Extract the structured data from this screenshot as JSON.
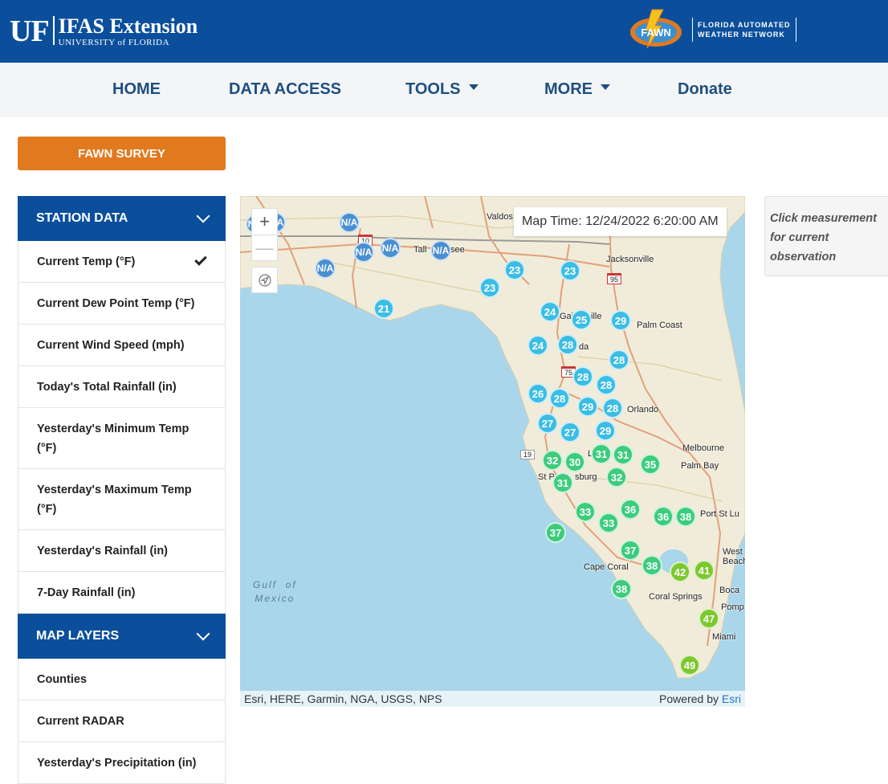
{
  "header": {
    "uf_mark": "UF",
    "org_title": "IFAS Extension",
    "org_subtitle": "UNIVERSITY of FLORIDA",
    "fawn_badge": "FAWN",
    "fawn_line1": "FLORIDA AUTOMATED",
    "fawn_line2": "WEATHER NETWORK"
  },
  "nav": {
    "items": [
      {
        "label": "HOME",
        "dropdown": false
      },
      {
        "label": "DATA ACCESS",
        "dropdown": false
      },
      {
        "label": "TOOLS",
        "dropdown": true
      },
      {
        "label": "MORE",
        "dropdown": true
      },
      {
        "label": "Donate",
        "dropdown": false
      }
    ]
  },
  "survey": {
    "label": "FAWN SURVEY"
  },
  "station_data": {
    "heading": "STATION DATA",
    "items": [
      {
        "label": "Current Temp (°F)",
        "selected": true
      },
      {
        "label": "Current Dew Point Temp (°F)"
      },
      {
        "label": "Current Wind Speed (mph)"
      },
      {
        "label": "Today's Total Rainfall (in)"
      },
      {
        "label": "Yesterday's Minimum Temp (°F)"
      },
      {
        "label": "Yesterday's Maximum Temp (°F)"
      },
      {
        "label": "Yesterday's Rainfall (in)"
      },
      {
        "label": "7-Day Rainfall (in)"
      }
    ]
  },
  "map_layers": {
    "heading": "MAP LAYERS",
    "items": [
      {
        "label": "Counties"
      },
      {
        "label": "Current RADAR"
      },
      {
        "label": "Yesterday's Precipitation (in)"
      }
    ]
  },
  "map": {
    "zoom_in": "+",
    "zoom_out": "—",
    "map_time": "Map Time: 12/24/2022 6:20:00 AM",
    "attribution_left": "Esri, HERE, Garmin, NGA, USGS, NPS",
    "attribution_powered": "Powered by",
    "attribution_esri": "Esri",
    "water_label": "Gulf  of\nMexico",
    "highway_shields": [
      "10",
      "95",
      "75",
      "19"
    ],
    "cities": [
      "Valdos",
      "Tall",
      "see",
      "Jacksonville",
      "Gai",
      "ille",
      "Palm Coast",
      "da",
      "Orlando",
      "Melbourne",
      "Palm Bay",
      "L",
      "St P",
      "sburg",
      "Port St Lu",
      "West",
      "Beach",
      "Cape Coral",
      "Coral Springs",
      "Boca",
      "Pomp",
      "Miami"
    ],
    "stations": [
      "N/A",
      "N/A",
      "N/A",
      "N/A",
      "N/A",
      "N/A",
      "N/A",
      "23",
      "23",
      "23",
      "21",
      "24",
      "25",
      "29",
      "24",
      "28",
      "28",
      "28",
      "28",
      "26",
      "28",
      "29",
      "28",
      "27",
      "27",
      "29",
      "31",
      "31",
      "32",
      "30",
      "35",
      "31",
      "32",
      "33",
      "36",
      "33",
      "36",
      "38",
      "37",
      "37",
      "38",
      "42",
      "41",
      "38",
      "47",
      "49"
    ],
    "colors": {
      "na": "#4a8fd1",
      "cool": "#3bbde4",
      "mid": "#3ccc7c",
      "warm": "#7cc82e"
    }
  },
  "info_panel": {
    "text": "Click measurement for current observation"
  }
}
